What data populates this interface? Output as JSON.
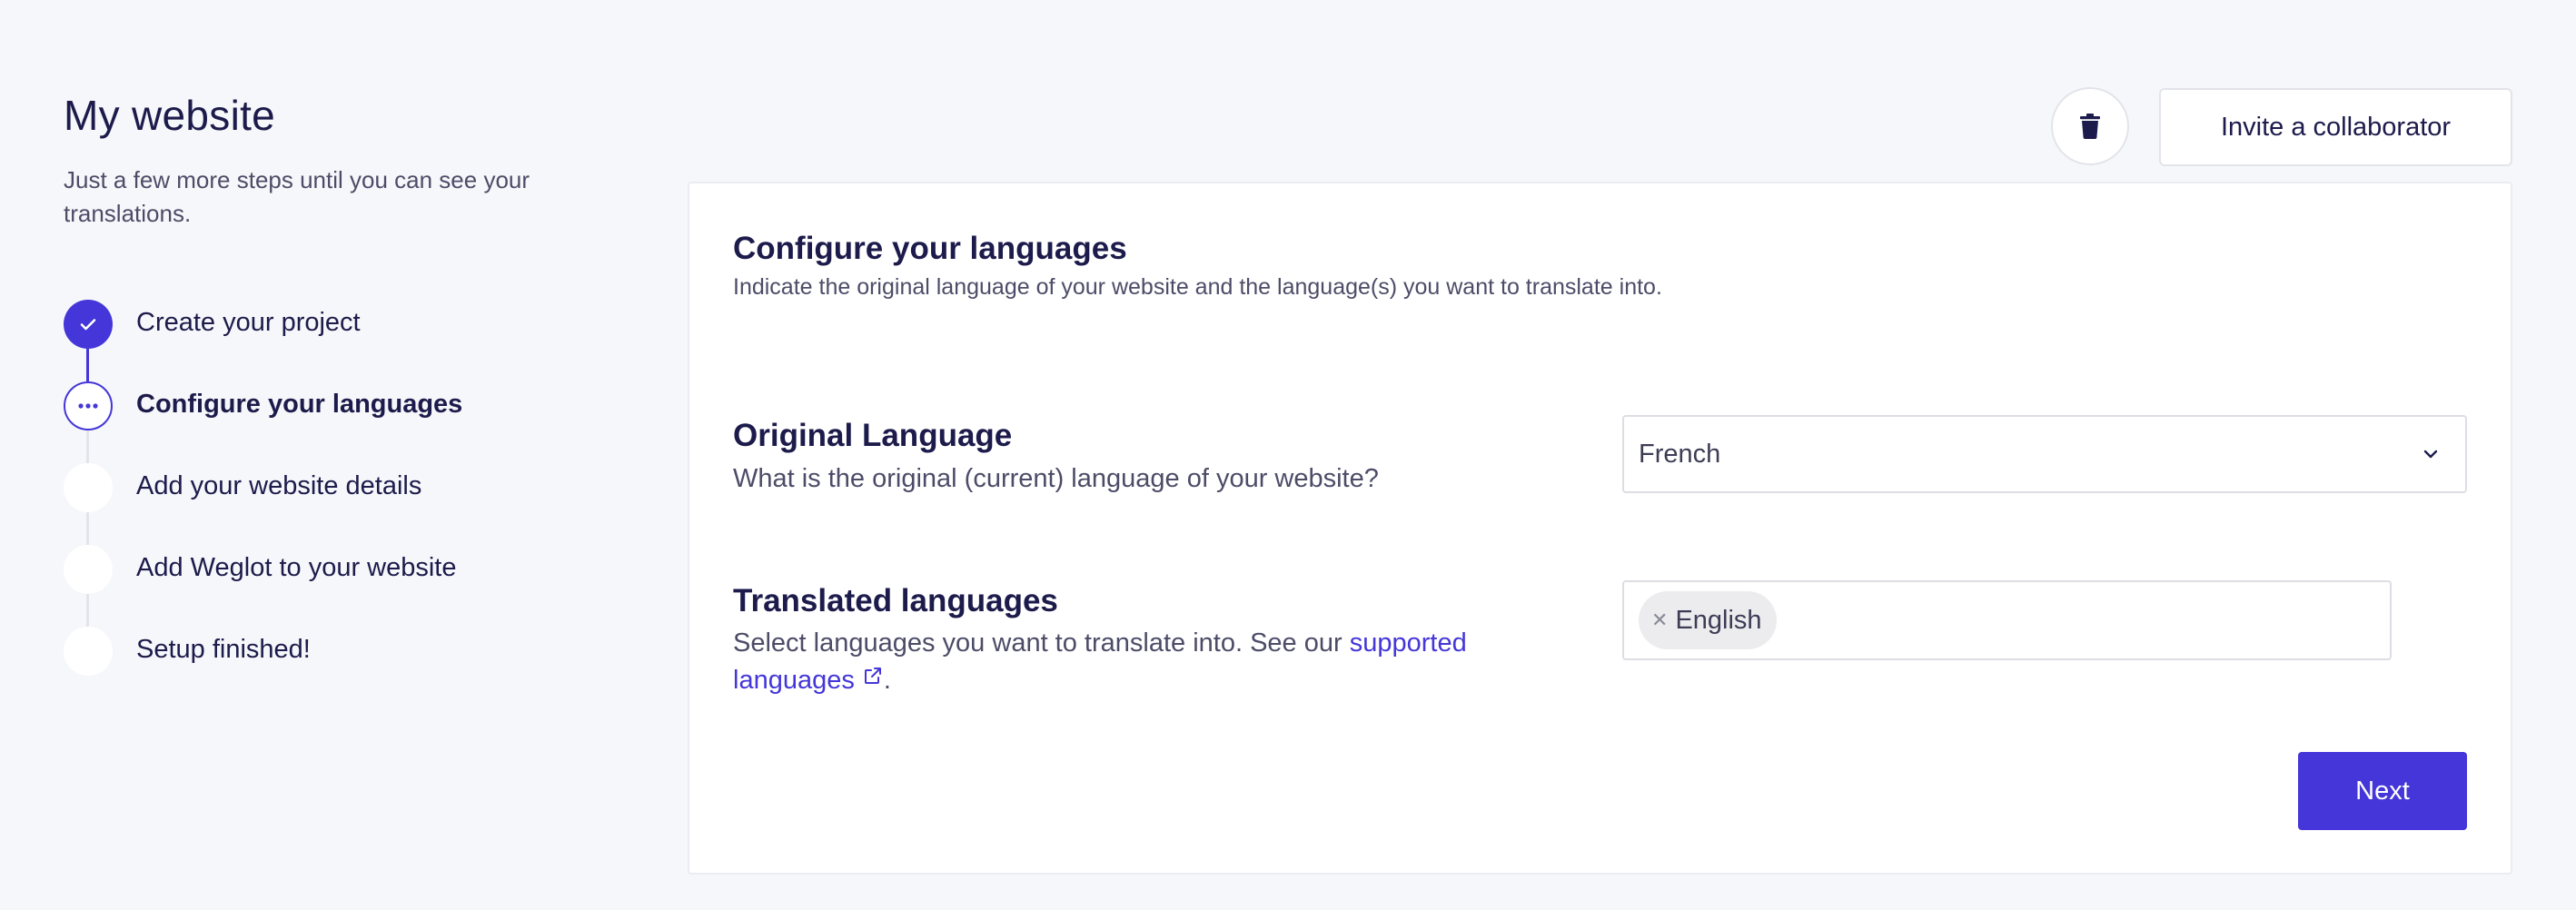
{
  "sidebar": {
    "title": "My website",
    "subtitle": "Just a few more steps until you can see your translations.",
    "steps": [
      {
        "label": "Create your project",
        "state": "done"
      },
      {
        "label": "Configure your languages",
        "state": "current"
      },
      {
        "label": "Add your website details",
        "state": "pending"
      },
      {
        "label": "Add Weglot to your website",
        "state": "pending"
      },
      {
        "label": "Setup finished!",
        "state": "pending"
      }
    ]
  },
  "header": {
    "delete_icon": "trash-icon",
    "invite_label": "Invite a collaborator"
  },
  "main": {
    "title": "Configure your languages",
    "description": "Indicate the original language of your website and the language(s) you want to translate into.",
    "original": {
      "label": "Original Language",
      "help": "What is the original (current) language of your website?",
      "value": "French"
    },
    "translated": {
      "label": "Translated languages",
      "help_prefix": "Select languages you want to translate into. See our ",
      "help_link": "supported languages",
      "help_suffix": ".",
      "tags": [
        "English"
      ]
    },
    "next_label": "Next"
  },
  "colors": {
    "accent": "#4436d8",
    "background": "#f6f7fa",
    "text": "#1c1b4b"
  }
}
